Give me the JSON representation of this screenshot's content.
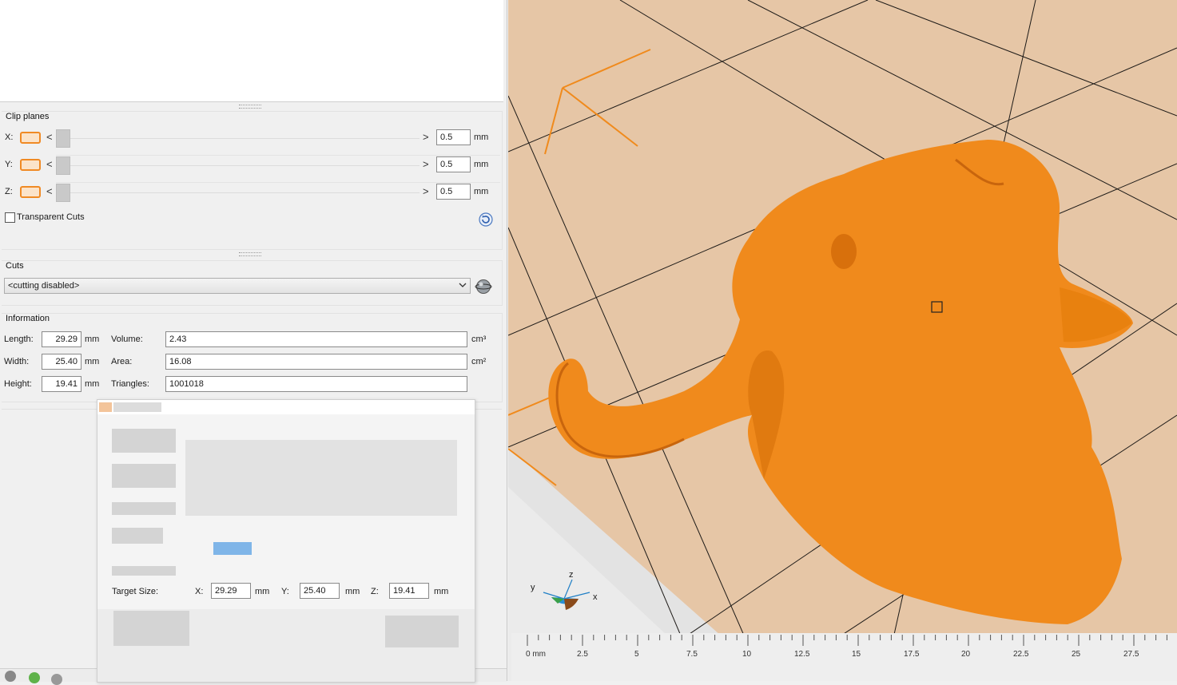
{
  "clip_planes": {
    "title": "Clip planes",
    "axes": [
      {
        "label": "X:",
        "value": "0.5",
        "unit": "mm"
      },
      {
        "label": "Y:",
        "value": "0.5",
        "unit": "mm"
      },
      {
        "label": "Z:",
        "value": "0.5",
        "unit": "mm"
      }
    ],
    "transparent_cuts_label": "Transparent Cuts",
    "transparent_cuts_checked": false,
    "prev_glyph": "<",
    "next_glyph": ">"
  },
  "cuts": {
    "title": "Cuts",
    "selected": "<cutting disabled>"
  },
  "information": {
    "title": "Information",
    "length_label": "Length:",
    "length_value": "29.29",
    "length_unit": "mm",
    "width_label": "Width:",
    "width_value": "25.40",
    "width_unit": "mm",
    "height_label": "Height:",
    "height_value": "19.41",
    "height_unit": "mm",
    "volume_label": "Volume:",
    "volume_value": "2.43",
    "volume_unit": "cm³",
    "area_label": "Area:",
    "area_value": "16.08",
    "area_unit": "cm²",
    "triangles_label": "Triangles:",
    "triangles_value": "1001018"
  },
  "scale_dialog": {
    "target_size_label": "Target Size:",
    "x_label": "X:",
    "x_value": "29.29",
    "y_label": "Y:",
    "y_value": "25.40",
    "z_label": "Z:",
    "z_value": "19.41",
    "unit": "mm"
  },
  "viewport": {
    "axis_gizmo": {
      "y": "y",
      "z": "z",
      "x": "x"
    },
    "ruler_ticks": [
      "0 mm",
      "2.5",
      "5",
      "7.5",
      "10",
      "12.5",
      "15",
      "17.5",
      "20",
      "22.5",
      "25",
      "27.5"
    ],
    "model_color": "#f08a1c",
    "plate_color": "#e6c6a6"
  },
  "icons": [
    "reset-icon",
    "cut-tool-icon",
    "dropdown-arrow-icon",
    "axis-gizmo-icon"
  ]
}
